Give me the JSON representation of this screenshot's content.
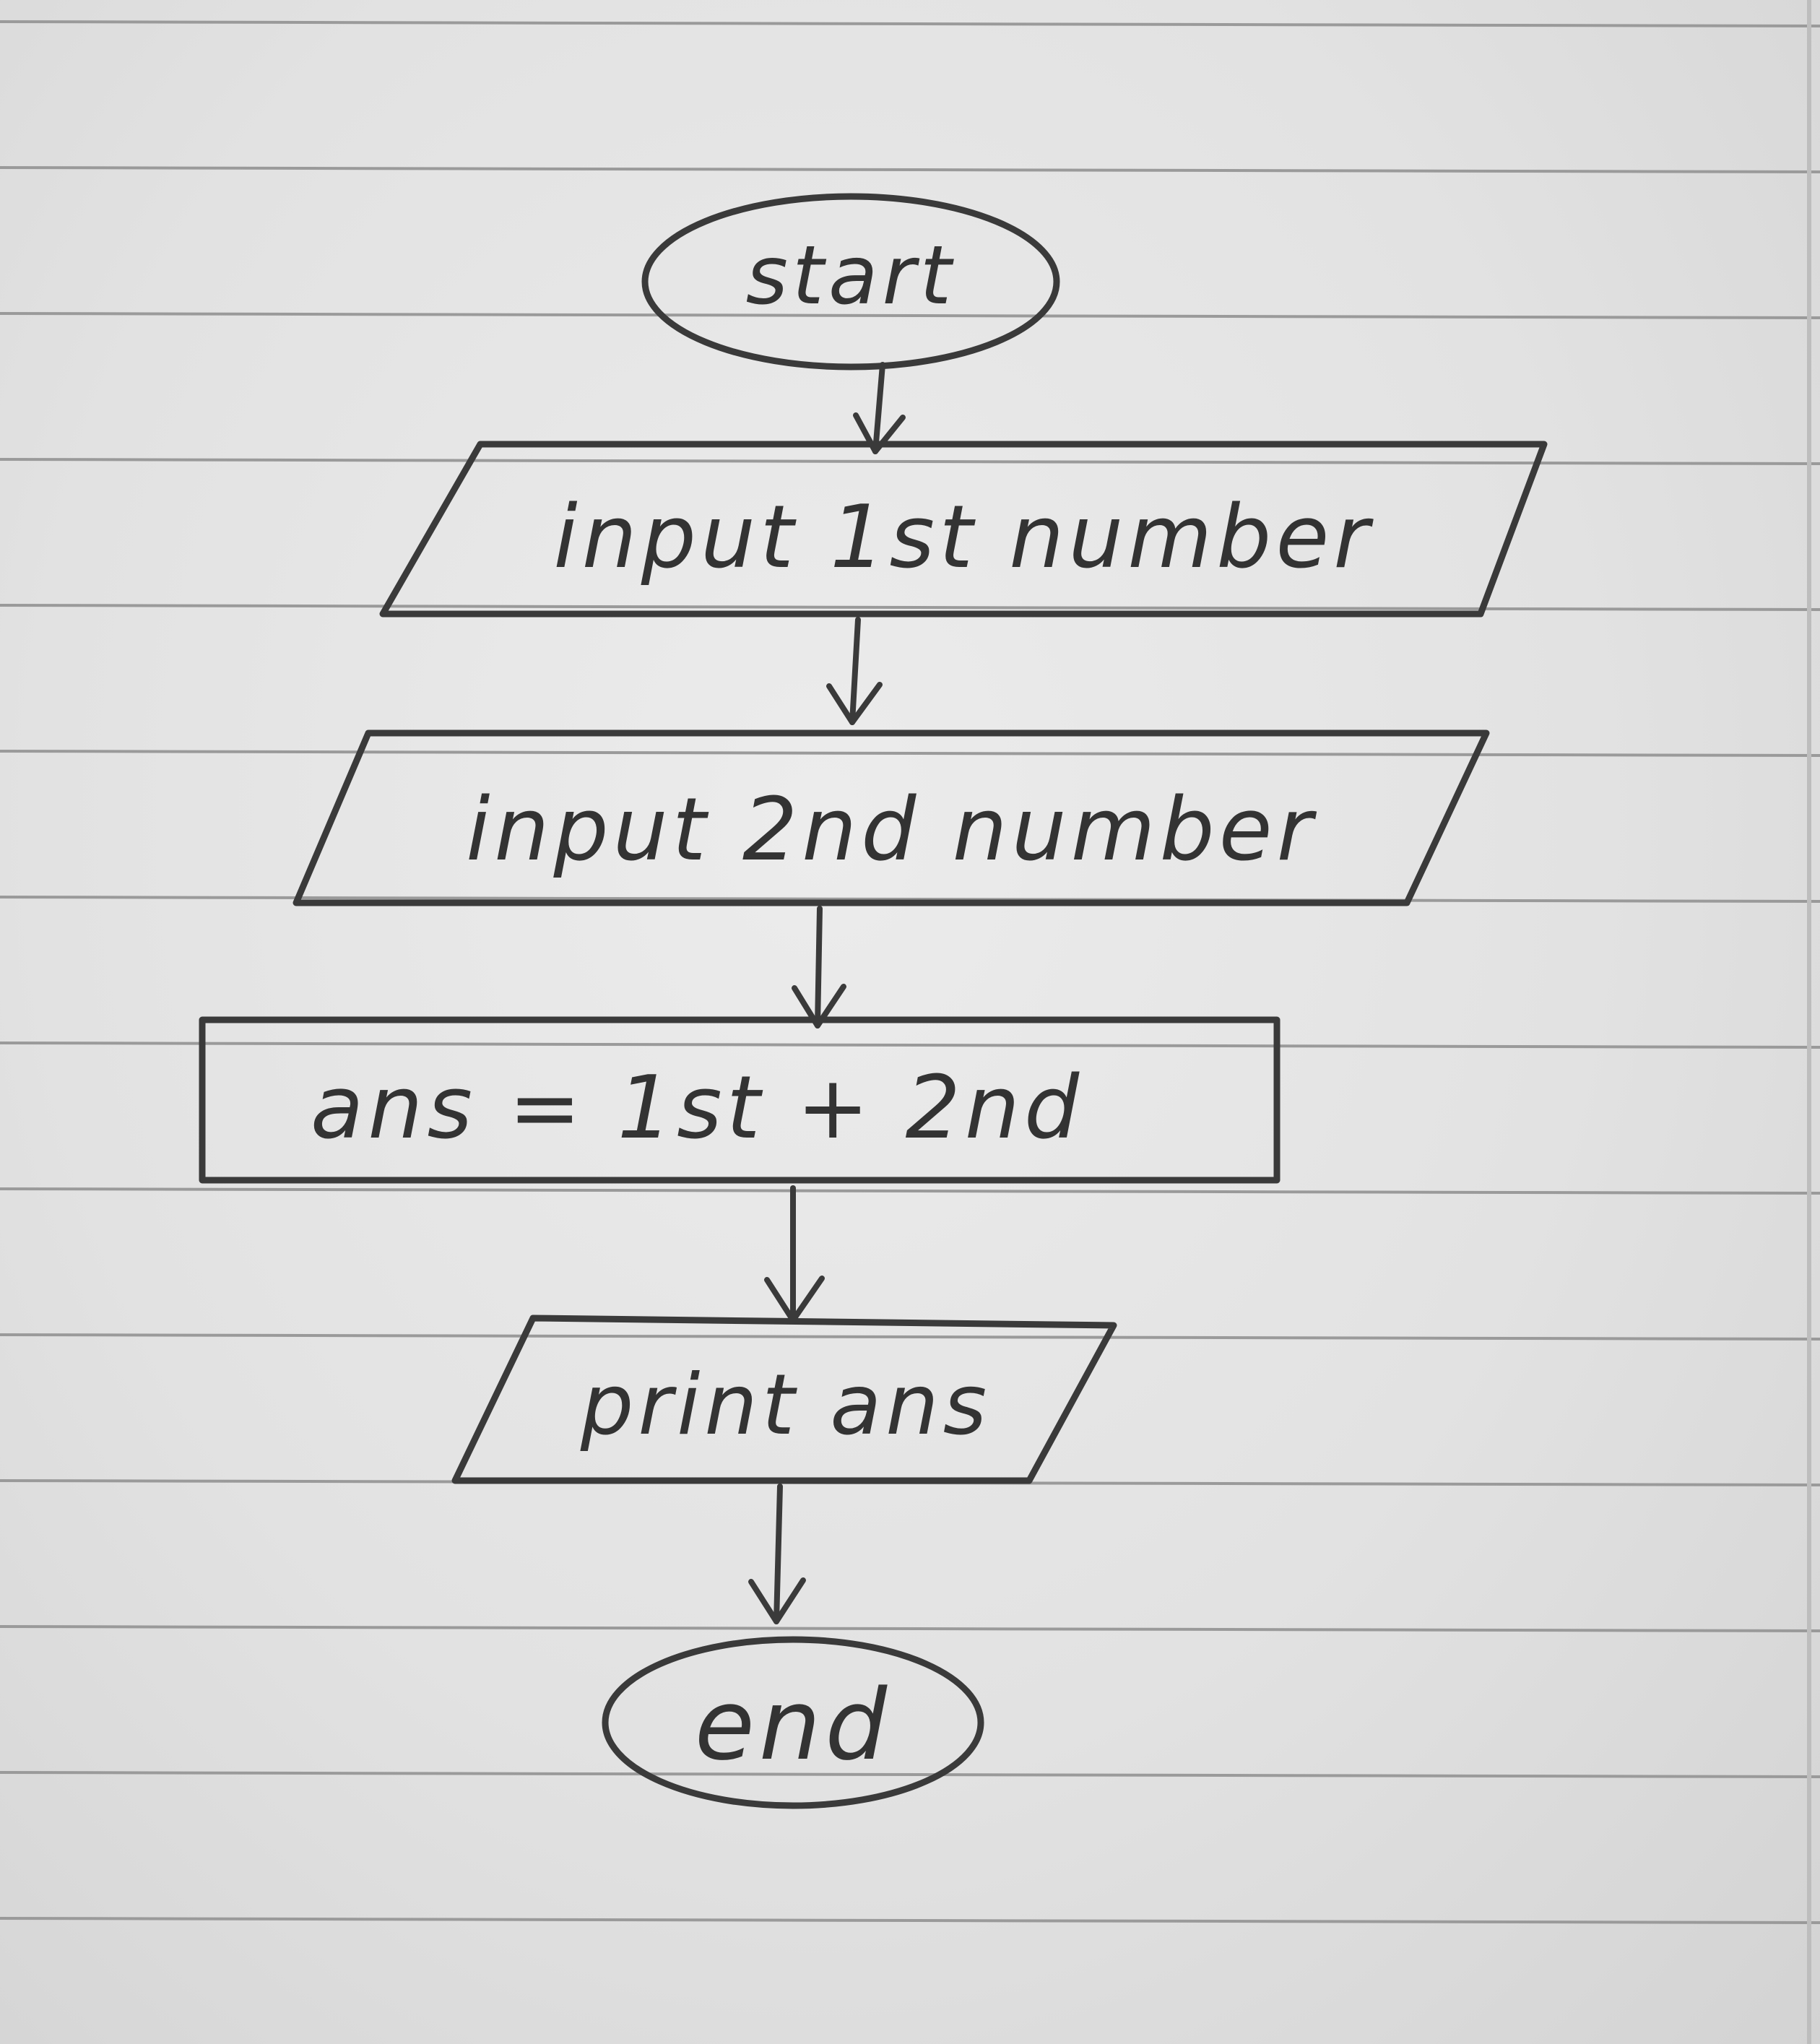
{
  "flowchart": {
    "nodes": [
      {
        "id": "start",
        "shape": "terminator",
        "label": "start"
      },
      {
        "id": "input1",
        "shape": "parallelogram",
        "label": "input 1st number"
      },
      {
        "id": "input2",
        "shape": "parallelogram",
        "label": "input 2nd number"
      },
      {
        "id": "process",
        "shape": "rectangle",
        "label": "ans = 1st + 2nd"
      },
      {
        "id": "output",
        "shape": "parallelogram",
        "label": "print ans"
      },
      {
        "id": "end",
        "shape": "terminator",
        "label": "end"
      }
    ],
    "edges": [
      {
        "from": "start",
        "to": "input1"
      },
      {
        "from": "input1",
        "to": "input2"
      },
      {
        "from": "input2",
        "to": "process"
      },
      {
        "from": "process",
        "to": "output"
      },
      {
        "from": "output",
        "to": "end"
      }
    ]
  },
  "colors": {
    "paper": "#e4e4e4",
    "ruled_line": "#9a9a9a",
    "pencil": "#3a3a3a"
  }
}
